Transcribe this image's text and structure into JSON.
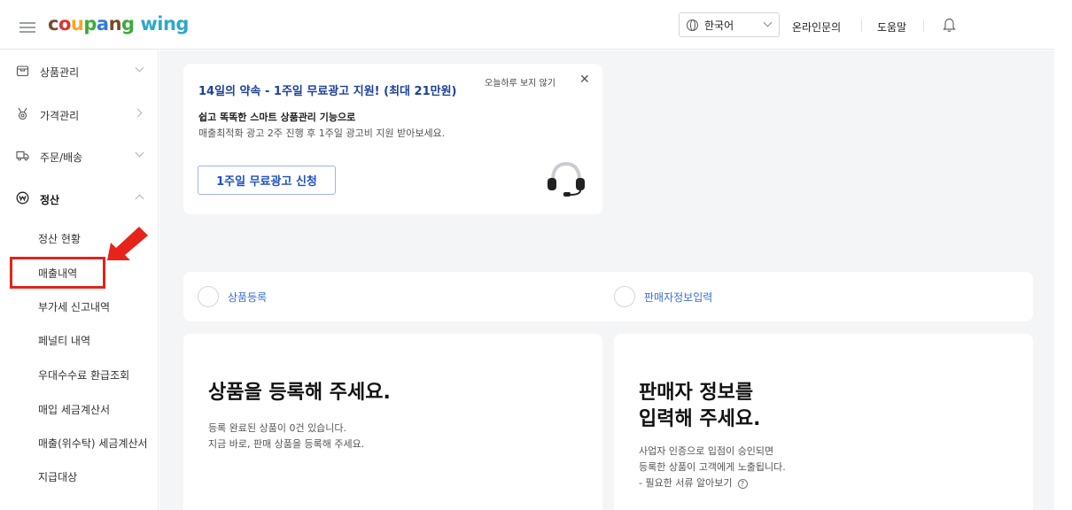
{
  "header": {
    "logo_parts": [
      "c",
      "o",
      "u",
      "p",
      "a",
      "n",
      "g"
    ],
    "logo_wing": "wing",
    "language": "한국어",
    "inquiry": "온라인문의",
    "help": "도움말"
  },
  "sidebar": {
    "menus": [
      {
        "label": "상품관리",
        "icon": "box-icon",
        "state": "collapsed"
      },
      {
        "label": "가격관리",
        "icon": "medal-icon",
        "state": "link"
      },
      {
        "label": "주문/배송",
        "icon": "truck-icon",
        "state": "collapsed"
      },
      {
        "label": "정산",
        "icon": "won-icon",
        "state": "expanded"
      }
    ],
    "sub_items": [
      "정산 현황",
      "매출내역",
      "부가세 신고내역",
      "페널티 내역",
      "우대수수료 환급조회",
      "매입 세금계산서",
      "매출(위수탁) 세금계산서",
      "지급대상"
    ],
    "highlighted_item": "매출내역"
  },
  "promo": {
    "title": "14일의 약속 - 1주일 무료광고 지원! (최대 21만원)",
    "dismiss": "오늘하루 보지 않기",
    "close": "✕",
    "subtitle": "쉽고 똑똑한 스마트 상품관리 기능으로",
    "description": "매출최적화 광고 2주 진행 후 1주일 광고비 지원 받아보세요.",
    "button": "1주일 무료광고 신청"
  },
  "steps": [
    {
      "label": "상품등록"
    },
    {
      "label": "판매자정보입력"
    }
  ],
  "product_card": {
    "title": "상품을 등록해 주세요.",
    "line1": "등록 완료된 상품이 0건 있습니다.",
    "line2": "지금 바로, 판매 상품을 등록해 주세요."
  },
  "seller_card": {
    "title_line1": "판매자 정보를",
    "title_line2": "입력해 주세요.",
    "line1": "사업자 인증으로 입점이 승인되면",
    "line2": "등록한 상품이 고객에게 노출됩니다.",
    "line3": "- 필요한 서류 알아보기",
    "help_glyph": "?"
  },
  "colors": {
    "accent_blue": "#1c50c4",
    "promo_title": "#1c3f9a",
    "highlight_red": "#e0251b",
    "background": "#f4f5f7"
  }
}
